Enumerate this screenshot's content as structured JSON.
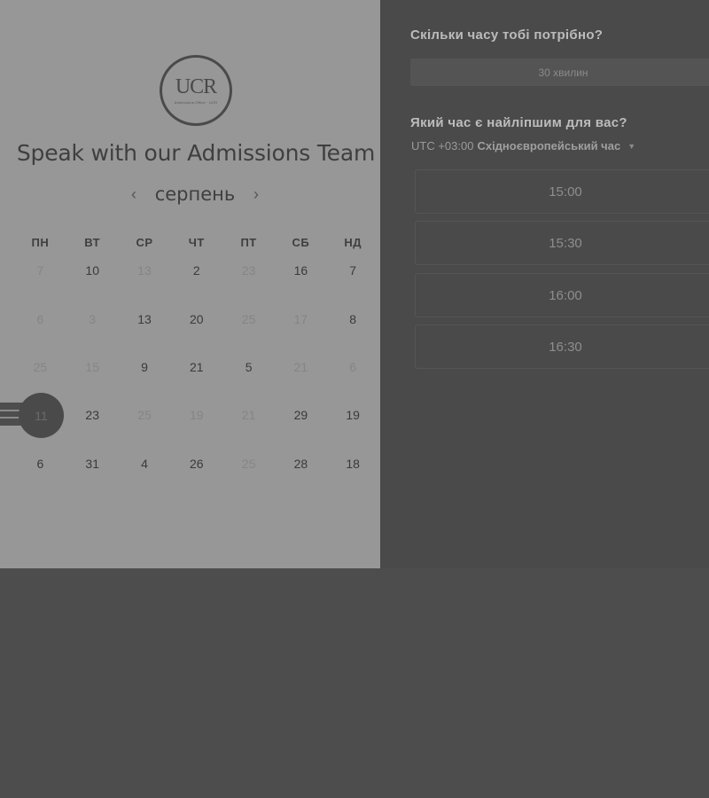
{
  "logo": {
    "mark": "UCR",
    "tag": "Admissions Office · UCR"
  },
  "title": "Speak with our Admissions Team",
  "calendar": {
    "month": "серпень",
    "weekdays": [
      "ПН",
      "ВТ",
      "СР",
      "ЧТ",
      "ПТ",
      "СБ",
      "НД"
    ],
    "weeks": [
      [
        {
          "d": "7",
          "m": true
        },
        {
          "d": "10",
          "m": false
        },
        {
          "d": "13",
          "m": true
        },
        {
          "d": "2",
          "m": false
        },
        {
          "d": "23",
          "m": true
        },
        {
          "d": "16",
          "m": false
        },
        {
          "d": "7",
          "m": false
        }
      ],
      [
        {
          "d": "6",
          "m": true
        },
        {
          "d": "3",
          "m": true
        },
        {
          "d": "13",
          "m": false
        },
        {
          "d": "20",
          "m": false
        },
        {
          "d": "25",
          "m": true
        },
        {
          "d": "17",
          "m": true
        },
        {
          "d": "8",
          "m": false
        }
      ],
      [
        {
          "d": "25",
          "m": true
        },
        {
          "d": "15",
          "m": true
        },
        {
          "d": "9",
          "m": false
        },
        {
          "d": "21",
          "m": false
        },
        {
          "d": "5",
          "m": false
        },
        {
          "d": "21",
          "m": true
        },
        {
          "d": "6",
          "m": true
        }
      ],
      [
        {
          "d": "11",
          "m": false
        },
        {
          "d": "23",
          "m": false
        },
        {
          "d": "25",
          "m": true
        },
        {
          "d": "19",
          "m": true
        },
        {
          "d": "21",
          "m": true
        },
        {
          "d": "29",
          "m": false
        },
        {
          "d": "19",
          "m": false
        }
      ],
      [
        {
          "d": "6",
          "m": false
        },
        {
          "d": "31",
          "m": false
        },
        {
          "d": "4",
          "m": false
        },
        {
          "d": "26",
          "m": false
        },
        {
          "d": "25",
          "m": true
        },
        {
          "d": "28",
          "m": false
        },
        {
          "d": "18",
          "m": false
        }
      ]
    ],
    "selected": "11"
  },
  "booking": {
    "duration_question": "Скільки часу тобі потрібно?",
    "duration_value": "30 хвилин",
    "time_question": "Який час є найліпшим для вас?",
    "tz_offset": "UTC +03:00",
    "tz_name": "Східноєвропейський час",
    "slots": [
      "15:00",
      "15:30",
      "16:00",
      "16:30"
    ]
  },
  "colors": {
    "left_panel": "#979797",
    "right_panel": "#4a4a4a",
    "selected": "#4a4a4a"
  },
  "icons": {
    "prev": "chevron-left-icon",
    "next": "chevron-right-icon",
    "tz_caret": "caret-down-icon"
  }
}
